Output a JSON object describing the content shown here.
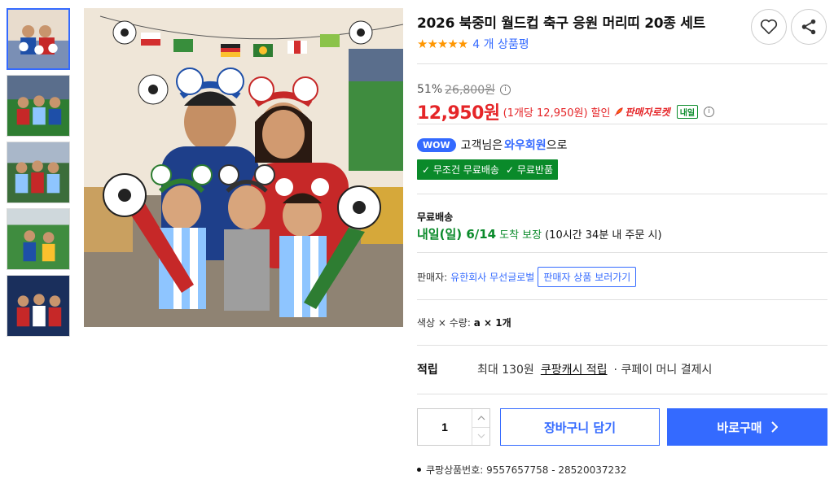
{
  "product": {
    "title": "2026 북중미 월드컵 축구 응원 머리띠 20종 세트",
    "stars": "★★★★★",
    "review_text": "4 개 상품평"
  },
  "pricing": {
    "discount_rate": "51%",
    "original_price": "26,800원",
    "sale_price": "12,950원",
    "unit_price": "(1개당 12,950원)",
    "discount_word": "할인",
    "rocket_label": "판매자로켓",
    "tomorrow_badge": "내일"
  },
  "wow": {
    "badge": "WOW",
    "prefix": "고객님은",
    "member": "와우회원",
    "suffix": "으로"
  },
  "benefits": [
    "✓ 무조건 무료배송",
    "✓ 무료반품"
  ],
  "shipping": {
    "label": "무료배송",
    "date": "내일(일) 6/14",
    "guarantee": "도착 보장",
    "condition": "(10시간 34분 내 주문 시)"
  },
  "seller": {
    "prefix": "판매자:",
    "name": "유한회사 무선글로벌",
    "button": "판매자 상품 보러가기"
  },
  "option": {
    "label": "색상 × 수량:",
    "value": "a × 1개"
  },
  "reward": {
    "label": "적립",
    "max": "최대 130원",
    "cash_link": "쿠팡캐시 적립",
    "condition": "· 쿠페이 머니 결제시"
  },
  "purchase": {
    "quantity": "1",
    "cart_label": "장바구니 담기",
    "buy_label": "바로구매"
  },
  "product_id": "쿠팡상품번호: 9557657758 - 28520037232",
  "colors": {
    "accent": "#346aff",
    "price_red": "#e52528",
    "free_green": "#0a8a2a",
    "star": "#ff9600"
  }
}
